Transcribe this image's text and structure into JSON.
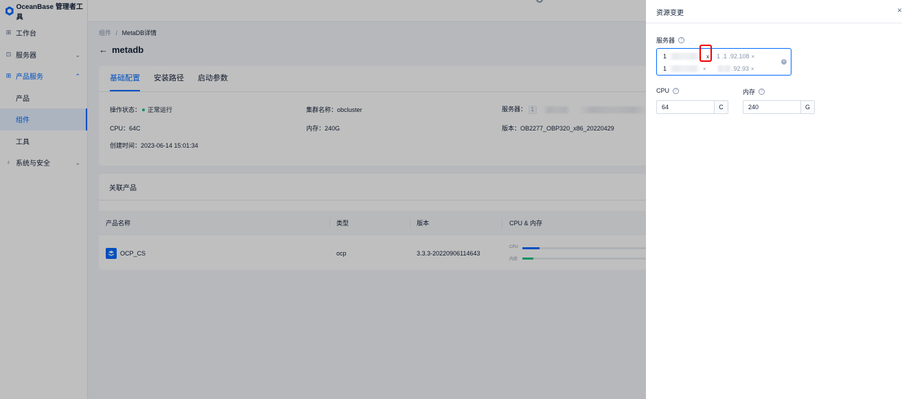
{
  "app": {
    "title": "OceanBase 管理者工具"
  },
  "sidebar": {
    "items": [
      {
        "label": "工作台",
        "icon": "grid-icon"
      },
      {
        "label": "服务器",
        "icon": "server-icon"
      },
      {
        "label": "产品服务",
        "icon": "grid-icon"
      },
      {
        "label": "产品"
      },
      {
        "label": "组件"
      },
      {
        "label": "工具"
      },
      {
        "label": "系统与安全",
        "icon": "security-icon"
      }
    ]
  },
  "breadcrumb": {
    "parent": "组件",
    "separator": "/",
    "current": "MetaDB详情"
  },
  "page": {
    "title": "metadb"
  },
  "tabs": [
    "基础配置",
    "安装路径",
    "启动参数"
  ],
  "basic_info": {
    "status_label": "操作状态：",
    "status_value": "正常运行",
    "cluster_label": "集群名称：",
    "cluster_value": "obcluster",
    "server_label": "服务器：",
    "server_tag": "1",
    "cpu_label": "CPU：",
    "cpu_value": "64C",
    "memory_label": "内存：",
    "memory_value": "240G",
    "version_label": "版本：",
    "version_value": "OB2277_OBP320_x86_20220429",
    "created_label": "创建时间：",
    "created_value": "2023-06-14 15:01:34"
  },
  "related": {
    "title": "关联产品",
    "columns": [
      "产品名称",
      "类型",
      "版本",
      "CPU & 内存"
    ],
    "rows": [
      {
        "name": "OCP_CS",
        "type": "ocp",
        "version": "3.3.3-20220906114643",
        "cpu_label": "CPU",
        "mem_label": "内存",
        "cpu_ratio": 0.14,
        "mem_ratio": 0.09
      }
    ]
  },
  "colors": {
    "primary": "#006aff",
    "success": "#0ac185",
    "highlight": "#e00000"
  },
  "drawer": {
    "title": "资源变更",
    "server_label": "服务器",
    "servers": [
      {
        "text": "1",
        "close": "x"
      },
      {
        "text": "1  .1 .92.108",
        "close": "×"
      },
      {
        "text": "1",
        "close": "×"
      },
      {
        "text": "  .92.93",
        "close": "×"
      }
    ],
    "cpu_label": "CPU",
    "cpu_value": "64",
    "cpu_unit": "C",
    "memory_label": "内存",
    "memory_value": "240",
    "memory_unit": "G"
  }
}
